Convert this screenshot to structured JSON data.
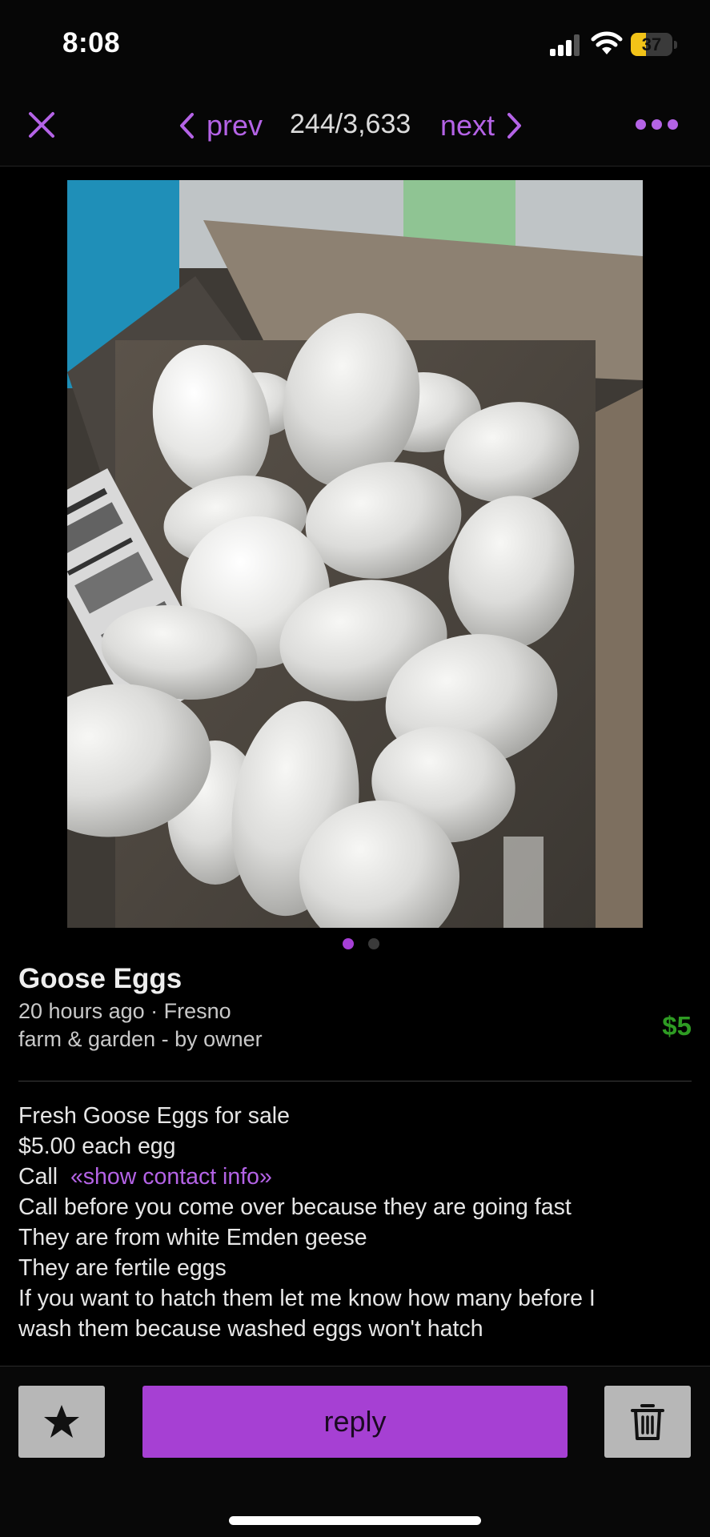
{
  "status_bar": {
    "time": "8:08",
    "battery_level": "37",
    "battery_fraction": 0.37,
    "signal_bars_active": 3,
    "icons": [
      "signal-icon",
      "wifi-icon",
      "battery-icon"
    ]
  },
  "nav": {
    "close_icon": "close-icon",
    "prev_label": "prev",
    "counter": "244/3,633",
    "next_label": "next",
    "more_icon": "more-dots-icon"
  },
  "gallery": {
    "image_count": 2,
    "active_index": 0
  },
  "listing": {
    "title": "Goose Eggs",
    "meta": "20 hours ago · Fresno",
    "category": "farm & garden - by owner",
    "price": "$5",
    "body": {
      "line1": "Fresh Goose Eggs for sale",
      "line2": "$5.00 each egg",
      "call_label": "Call",
      "contact_link": "«show contact info»",
      "line4": "Call before you come over because they are going fast",
      "line5": "They are from white Emden geese",
      "line6": "They are fertile eggs",
      "line7": "If you want to hatch them let me know how many before I",
      "line8": "wash them because washed eggs won't hatch"
    }
  },
  "actions": {
    "favorite_icon": "star-icon",
    "reply_label": "reply",
    "delete_icon": "trash-icon"
  },
  "colors": {
    "accent": "#b463e6",
    "reply_button": "#a640d3",
    "price": "#2e9b23",
    "background": "#000000"
  }
}
